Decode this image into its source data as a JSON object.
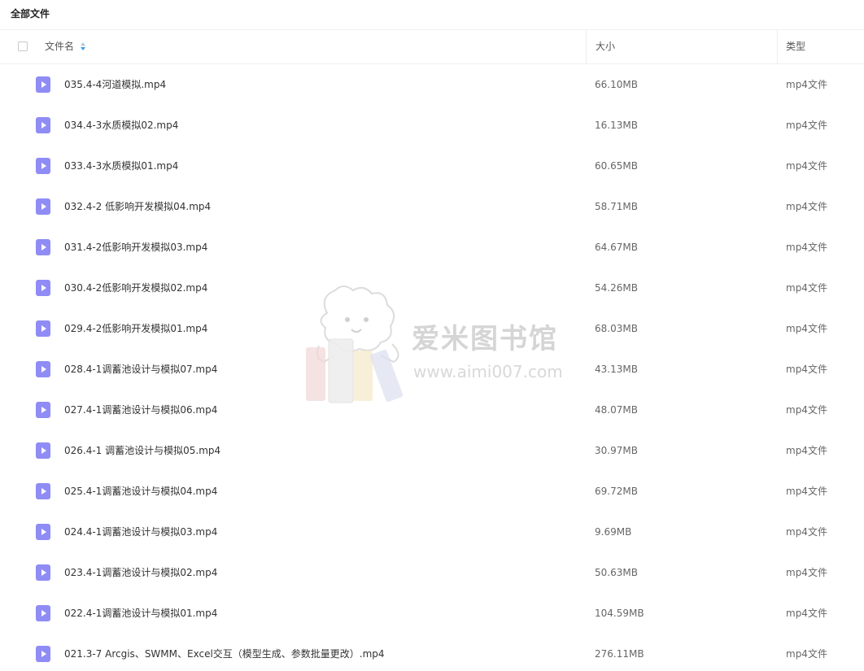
{
  "breadcrumb": "全部文件",
  "header": {
    "name": "文件名",
    "size": "大小",
    "type": "类型"
  },
  "files": [
    {
      "name": "035.4-4河道模拟.mp4",
      "size": "66.10MB",
      "type": "mp4文件"
    },
    {
      "name": "034.4-3水质模拟02.mp4",
      "size": "16.13MB",
      "type": "mp4文件"
    },
    {
      "name": "033.4-3水质模拟01.mp4",
      "size": "60.65MB",
      "type": "mp4文件"
    },
    {
      "name": "032.4-2 低影响开发模拟04.mp4",
      "size": "58.71MB",
      "type": "mp4文件"
    },
    {
      "name": "031.4-2低影响开发模拟03.mp4",
      "size": "64.67MB",
      "type": "mp4文件"
    },
    {
      "name": "030.4-2低影响开发模拟02.mp4",
      "size": "54.26MB",
      "type": "mp4文件"
    },
    {
      "name": "029.4-2低影响开发模拟01.mp4",
      "size": "68.03MB",
      "type": "mp4文件"
    },
    {
      "name": "028.4-1调蓄池设计与模拟07.mp4",
      "size": "43.13MB",
      "type": "mp4文件"
    },
    {
      "name": "027.4-1调蓄池设计与模拟06.mp4",
      "size": "48.07MB",
      "type": "mp4文件"
    },
    {
      "name": "026.4-1 调蓄池设计与模拟05.mp4",
      "size": "30.97MB",
      "type": "mp4文件"
    },
    {
      "name": "025.4-1调蓄池设计与模拟04.mp4",
      "size": "69.72MB",
      "type": "mp4文件"
    },
    {
      "name": "024.4-1调蓄池设计与模拟03.mp4",
      "size": "9.69MB",
      "type": "mp4文件"
    },
    {
      "name": "023.4-1调蓄池设计与模拟02.mp4",
      "size": "50.63MB",
      "type": "mp4文件"
    },
    {
      "name": "022.4-1调蓄池设计与模拟01.mp4",
      "size": "104.59MB",
      "type": "mp4文件"
    },
    {
      "name": "021.3-7 Arcgis、SWMM、Excel交互（模型生成、参数批量更改）.mp4",
      "size": "276.11MB",
      "type": "mp4文件"
    }
  ],
  "watermark": {
    "title": "爱米图书馆",
    "url": "www.aimi007.com"
  },
  "icons": {
    "file": "video-file-icon",
    "sort": "sort-icon"
  },
  "colors": {
    "file_icon": "#8f8cf6",
    "sort_active": "#3aa0e8"
  }
}
